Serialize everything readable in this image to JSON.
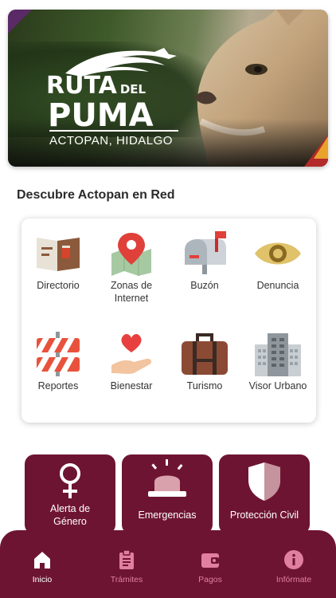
{
  "banner": {
    "title_line1": "RUTA",
    "title_small": "DEL",
    "title_line2": "PUMA",
    "subtitle": "ACTOPAN, HIDALGO"
  },
  "section_title": "Descubre Actopan en Red",
  "services": [
    {
      "label": "Directorio",
      "icon": "directory-book-icon"
    },
    {
      "label": "Zonas de Internet",
      "icon": "map-pin-icon"
    },
    {
      "label": "Buzón",
      "icon": "mailbox-icon"
    },
    {
      "label": "Denuncia",
      "icon": "eye-icon"
    },
    {
      "label": "Reportes",
      "icon": "barrier-icon"
    },
    {
      "label": "Bienestar",
      "icon": "heart-hand-icon"
    },
    {
      "label": "Turismo",
      "icon": "suitcase-icon"
    },
    {
      "label": "Visor Urbano",
      "icon": "buildings-icon"
    }
  ],
  "tiles": [
    {
      "label": "Alerta de Género",
      "icon": "female-symbol-icon"
    },
    {
      "label": "Emergencias",
      "icon": "siren-icon"
    },
    {
      "label": "Protección Civil",
      "icon": "shield-icon"
    }
  ],
  "nav": [
    {
      "label": "Inicio",
      "icon": "home-icon",
      "active": true
    },
    {
      "label": "Trámites",
      "icon": "clipboard-icon",
      "active": false
    },
    {
      "label": "Pagos",
      "icon": "wallet-icon",
      "active": false
    },
    {
      "label": "Infórmate",
      "icon": "info-icon",
      "active": false
    }
  ],
  "colors": {
    "brand": "#6e1433",
    "nav_muted": "#e07fa0"
  }
}
